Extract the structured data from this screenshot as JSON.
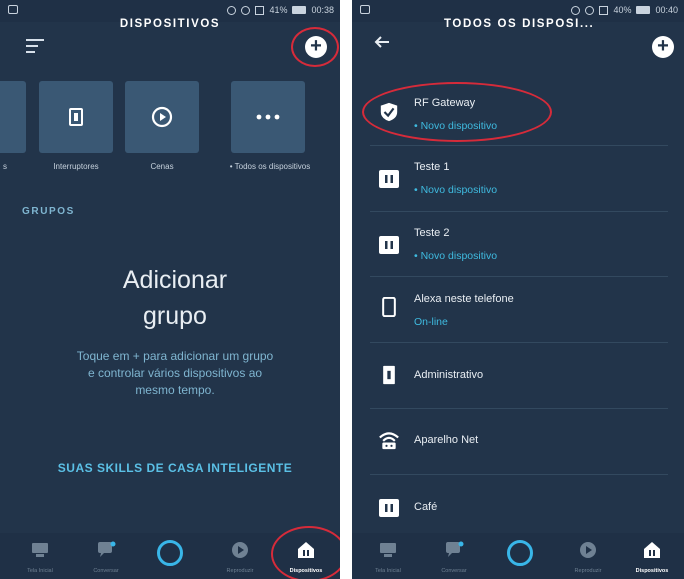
{
  "left": {
    "status": {
      "time": "00:38",
      "battery": "41%"
    },
    "header": {
      "title": "DISPOSITIVOS"
    },
    "categories": [
      {
        "label": "s",
        "icon": "partial-tile-icon"
      },
      {
        "label": "Interruptores",
        "icon": "switch-icon"
      },
      {
        "label": "Cenas",
        "icon": "play-circle-icon"
      },
      {
        "label": "• Todos os dispositivos",
        "icon": "more-dots-icon"
      }
    ],
    "groups": {
      "heading": "GRUPOS",
      "empty_title_line1": "Adicionar",
      "empty_title_line2": "grupo",
      "empty_desc": "Toque em + para adicionar um grupo e controlar vários dispositivos ao mesmo tempo."
    },
    "skills_link": "SUAS SKILLS DE CASA INTELIGENTE",
    "nav": [
      {
        "label": "Tela Inicial"
      },
      {
        "label": "Conversar"
      },
      {
        "label": ""
      },
      {
        "label": "Reproduzir"
      },
      {
        "label": "Dispositivos"
      }
    ]
  },
  "right": {
    "status": {
      "time": "00:40",
      "battery": "40%"
    },
    "header": {
      "title": "TODOS OS DISPOSI..."
    },
    "devices": [
      {
        "name": "RF Gateway",
        "status": "• Novo dispositivo",
        "icon": "shield-check-icon"
      },
      {
        "name": "Teste 1",
        "status": "• Novo dispositivo",
        "icon": "plug-icon"
      },
      {
        "name": "Teste 2",
        "status": "• Novo dispositivo",
        "icon": "plug-icon"
      },
      {
        "name": "Alexa neste telefone",
        "status": "On-line",
        "icon": "phone-icon"
      },
      {
        "name": "Administrativo",
        "status": "",
        "icon": "switch-icon"
      },
      {
        "name": "Aparelho Net",
        "status": "",
        "icon": "wifi-router-icon"
      },
      {
        "name": "Café",
        "status": "",
        "icon": "plug-icon"
      }
    ],
    "nav": [
      {
        "label": "Tela Inicial"
      },
      {
        "label": "Conversar"
      },
      {
        "label": ""
      },
      {
        "label": "Reproduzir"
      },
      {
        "label": "Dispositivos"
      }
    ]
  },
  "colors": {
    "background": "#22344a",
    "accent": "#3fbbe0",
    "annotation": "#d62b3a"
  }
}
